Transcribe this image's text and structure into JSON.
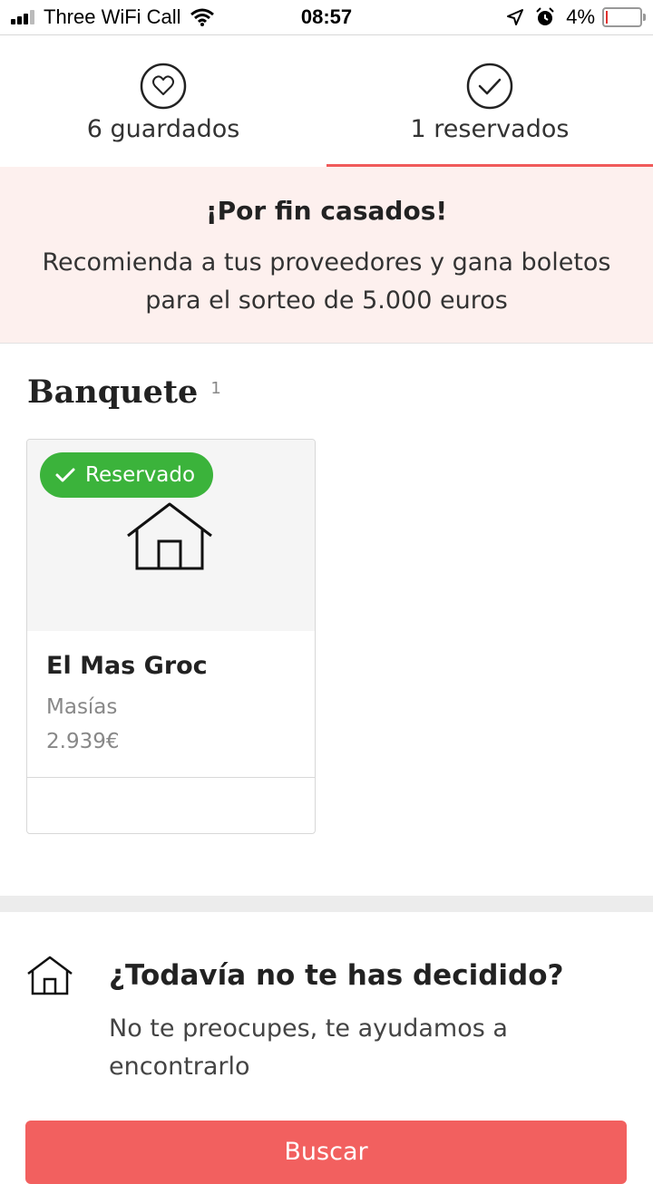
{
  "status_bar": {
    "carrier": "Three WiFi Call",
    "time": "08:57",
    "battery": "4%"
  },
  "tabs": [
    {
      "label": "6 guardados",
      "icon": "heart-icon",
      "active": false
    },
    {
      "label": "1 reservados",
      "icon": "check-circle-icon",
      "active": true
    }
  ],
  "banner": {
    "title": "¡Por fin casados!",
    "text": "Recomienda a tus proveedores y gana boletos para el sorteo de 5.000 euros"
  },
  "section": {
    "title": "Banquete",
    "count": "1"
  },
  "card": {
    "badge": "Reservado",
    "name": "El Mas Groc",
    "category": "Masías",
    "price": "2.939€"
  },
  "help": {
    "title": "¿Todavía no te has decidido?",
    "text": "No te preocupes, te ayudamos a encontrarlo"
  },
  "button": {
    "label": "Buscar"
  },
  "colors": {
    "accent": "#f05a5a",
    "banner_bg": "#fdf0ee",
    "badge_green": "#3bb33b",
    "button_bg": "#f2605f"
  }
}
